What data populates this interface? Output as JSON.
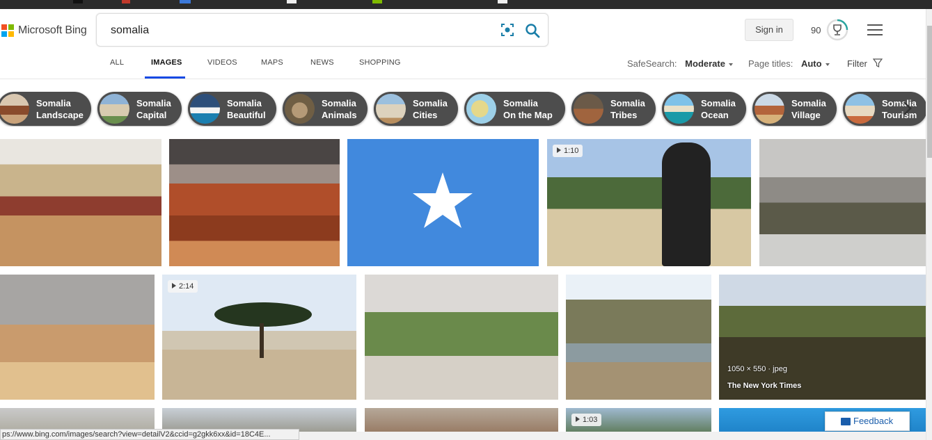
{
  "brand": {
    "name": "Microsoft Bing",
    "colors": [
      "#f25022",
      "#7fba00",
      "#00a4ef",
      "#ffb900"
    ]
  },
  "search": {
    "query": "somalia"
  },
  "header": {
    "sign_in": "Sign in",
    "points": "90"
  },
  "tabs": [
    {
      "label": "ALL",
      "active": false
    },
    {
      "label": "IMAGES",
      "active": true
    },
    {
      "label": "VIDEOS",
      "active": false
    },
    {
      "label": "MAPS",
      "active": false
    },
    {
      "label": "NEWS",
      "active": false
    },
    {
      "label": "SHOPPING",
      "active": false
    }
  ],
  "filters": {
    "safesearch_label": "SafeSearch:",
    "safesearch_value": "Moderate",
    "pagetitles_label": "Page titles:",
    "pagetitles_value": "Auto",
    "filter_label": "Filter"
  },
  "chips": [
    {
      "line1": "Somalia",
      "line2": "Landscape"
    },
    {
      "line1": "Somalia",
      "line2": "Capital"
    },
    {
      "line1": "Somalia",
      "line2": "Beautiful"
    },
    {
      "line1": "Somalia",
      "line2": "Animals"
    },
    {
      "line1": "Somalia",
      "line2": "Cities"
    },
    {
      "line1": "Somalia",
      "line2": "On the Map"
    },
    {
      "line1": "Somalia",
      "line2": "Tribes"
    },
    {
      "line1": "Somalia",
      "line2": "Ocean"
    },
    {
      "line1": "Somalia",
      "line2": "Village"
    },
    {
      "line1": "Somalia",
      "line2": "Tourism"
    }
  ],
  "results": {
    "video1": "1:10",
    "video2": "2:14",
    "video3": "1:03",
    "hover_size": "1050 × 550 · jpeg",
    "hover_source": "The New York Times"
  },
  "status_url": "ps://www.bing.com/images/search?view=detailV2&ccid=g2gkk6xx&id=18C4E...",
  "feedback": "Feedback",
  "accent": "#174ae4",
  "link_color": "#1a5dab"
}
